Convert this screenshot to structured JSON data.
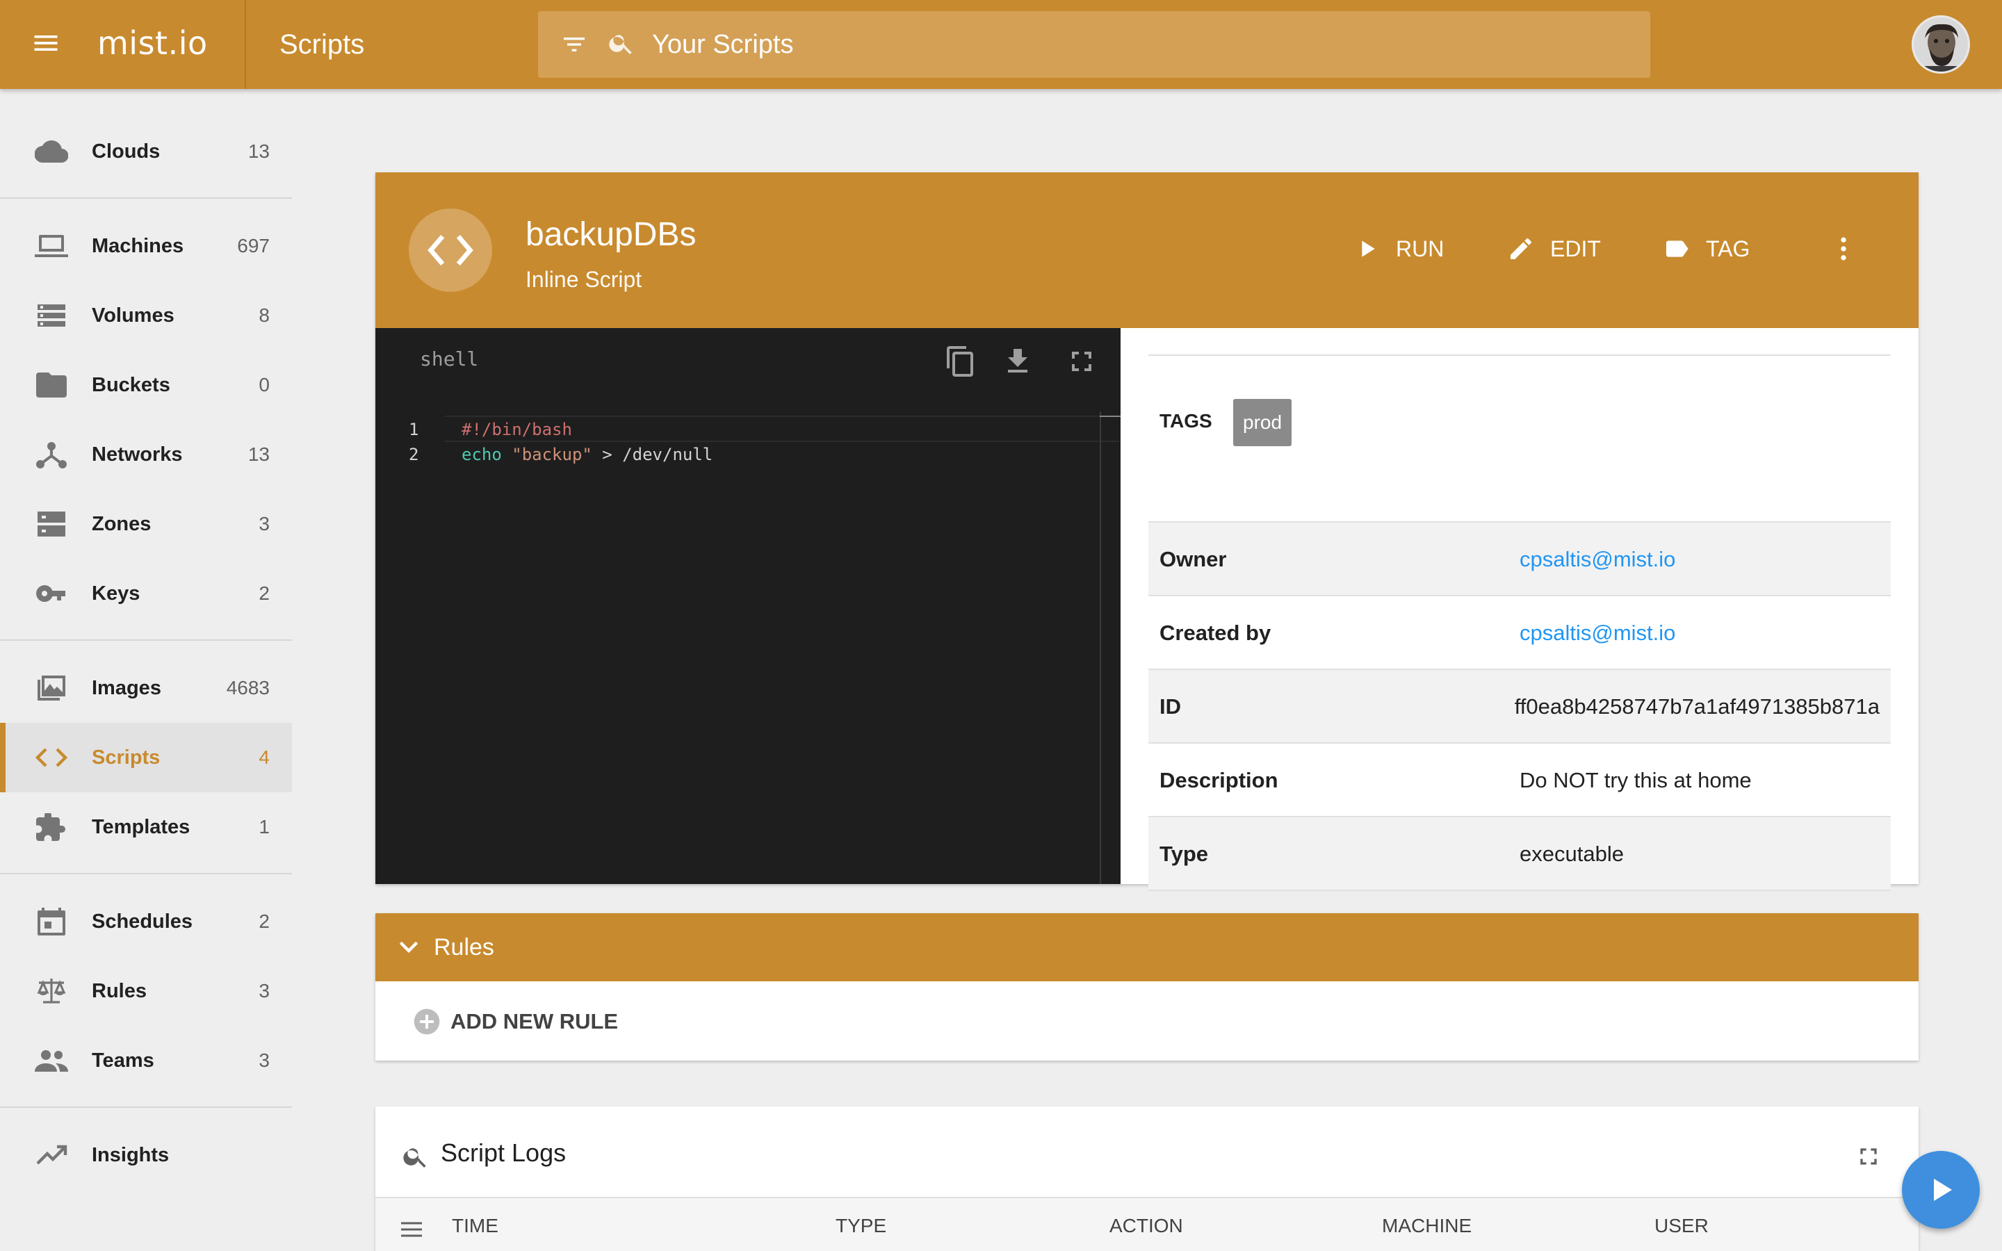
{
  "topbar": {
    "logo": "mist.io",
    "title": "Scripts",
    "search_placeholder": "Your Scripts"
  },
  "sidebar": {
    "items": [
      {
        "label": "Clouds",
        "count": "13",
        "icon": "cloud-icon"
      },
      {
        "label": "Machines",
        "count": "697",
        "icon": "laptop-icon"
      },
      {
        "label": "Volumes",
        "count": "8",
        "icon": "storage-icon"
      },
      {
        "label": "Buckets",
        "count": "0",
        "icon": "folder-icon"
      },
      {
        "label": "Networks",
        "count": "13",
        "icon": "network-icon"
      },
      {
        "label": "Zones",
        "count": "3",
        "icon": "dns-icon"
      },
      {
        "label": "Keys",
        "count": "2",
        "icon": "key-icon"
      },
      {
        "label": "Images",
        "count": "4683",
        "icon": "image-icon"
      },
      {
        "label": "Scripts",
        "count": "4",
        "icon": "code-icon",
        "active": true
      },
      {
        "label": "Templates",
        "count": "1",
        "icon": "puzzle-icon"
      },
      {
        "label": "Schedules",
        "count": "2",
        "icon": "calendar-icon"
      },
      {
        "label": "Rules",
        "count": "3",
        "icon": "scale-icon"
      },
      {
        "label": "Teams",
        "count": "3",
        "icon": "people-icon"
      },
      {
        "label": "Insights",
        "count": "",
        "icon": "trending-up-icon"
      }
    ]
  },
  "script": {
    "name": "backupDBs",
    "subtitle": "Inline Script",
    "actions": {
      "run": "RUN",
      "edit": "EDIT",
      "tag": "TAG"
    },
    "editor": {
      "language": "shell",
      "lines": [
        {
          "n": "1",
          "tokens": [
            {
              "t": "#!/bin/bash",
              "c": "shebang"
            }
          ]
        },
        {
          "n": "2",
          "tokens": [
            {
              "t": "echo ",
              "c": "cmd"
            },
            {
              "t": "\"backup\"",
              "c": "str"
            },
            {
              "t": " > /dev/null",
              "c": "plain"
            }
          ]
        }
      ]
    },
    "tags_label": "TAGS",
    "tags": [
      "prod"
    ],
    "details": [
      {
        "key": "Owner",
        "value": "cpsaltis@mist.io",
        "link": true
      },
      {
        "key": "Created by",
        "value": "cpsaltis@mist.io",
        "link": true
      },
      {
        "key": "ID",
        "value": "ff0ea8b4258747b7a1af4971385b871a"
      },
      {
        "key": "Description",
        "value": "Do NOT try this at home"
      },
      {
        "key": "Type",
        "value": "executable"
      }
    ]
  },
  "rules": {
    "title": "Rules",
    "add_label": "ADD NEW RULE"
  },
  "logs": {
    "title": "Script Logs",
    "columns": [
      "TIME",
      "TYPE",
      "ACTION",
      "MACHINE",
      "USER"
    ]
  },
  "colors": {
    "accent": "#c88a2e",
    "link": "#2196f3",
    "fab": "#3f8fde"
  }
}
